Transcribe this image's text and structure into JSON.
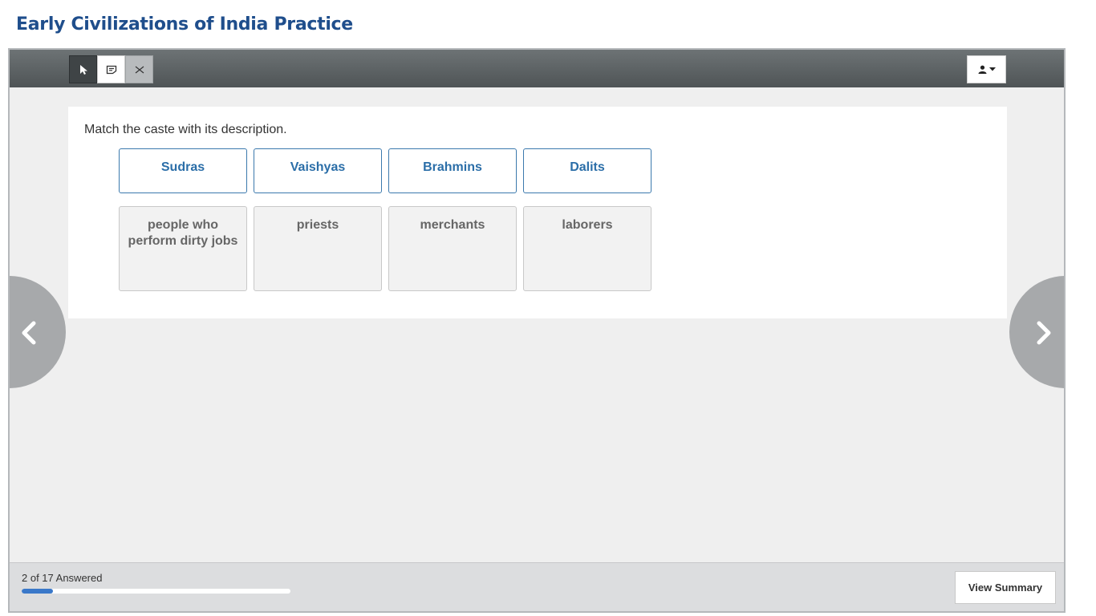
{
  "page": {
    "title": "Early Civilizations of India Practice"
  },
  "toolbar": {
    "tools": [
      {
        "name": "pointer",
        "icon": "cursor-arrow-icon",
        "active": true
      },
      {
        "name": "notepad",
        "icon": "note-icon"
      },
      {
        "name": "eliminator",
        "icon": "eliminate-icon"
      }
    ],
    "account_icon": "user-icon"
  },
  "question": {
    "prompt": "Match the caste with its description.",
    "terms": [
      "Sudras",
      "Vaishyas",
      "Brahmins",
      "Dalits"
    ],
    "descriptions": [
      "people who perform dirty jobs",
      "priests",
      "merchants",
      "laborers"
    ]
  },
  "navigation": {
    "prev_icon": "chevron-left-icon",
    "next_icon": "chevron-right-icon"
  },
  "footer": {
    "answered_text": "2 of 17 Answered",
    "answered": 2,
    "total": 17,
    "summary_label": "View Summary"
  },
  "colors": {
    "title": "#1f4e8c",
    "term_text": "#2b6ea8",
    "progress_fill": "#3a78c9",
    "toolbar": "#5e6466"
  }
}
